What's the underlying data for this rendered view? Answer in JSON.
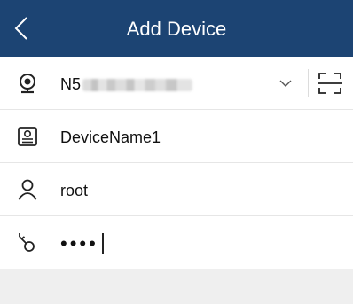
{
  "header": {
    "title": "Add Device",
    "back_icon": "chevron-left-icon",
    "background": "#1c4473"
  },
  "form": {
    "serial": {
      "icon": "camera-icon",
      "value": "N5",
      "dropdown_icon": "chevron-down-icon",
      "scan_icon": "scan-qr-icon"
    },
    "device_name": {
      "icon": "device-id-icon",
      "value": "DeviceName1"
    },
    "username": {
      "icon": "user-icon",
      "value": "root"
    },
    "password": {
      "icon": "key-icon",
      "value": "••••"
    }
  }
}
